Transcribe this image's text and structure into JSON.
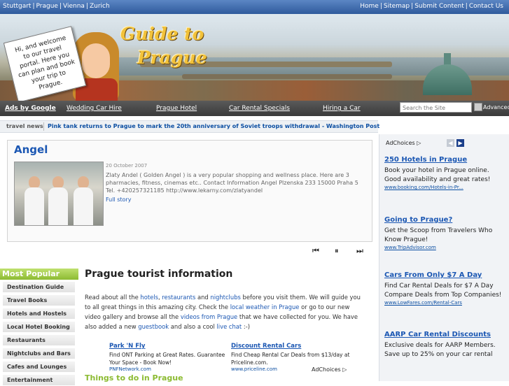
{
  "topbar": {
    "cities": [
      "Stuttgart",
      "Prague",
      "Vienna",
      "Zurich"
    ],
    "links": [
      "Home",
      "Sitemap",
      "Submit Content",
      "Contact Us"
    ]
  },
  "banner": {
    "title_line1": "Guide to",
    "title_line2": "Prague",
    "sign_text": "Hi, and welcome to our travel portal. Here you can plan and book your trip to Prague."
  },
  "nav": {
    "ads_label": "Ads by Google",
    "links": [
      "Wedding Car Hire",
      "Prague Hotel",
      "Car Rental Specials",
      "Hiring a Car"
    ],
    "search_placeholder": "Search the Site",
    "advanced_label": "Advanced"
  },
  "news": {
    "label": "travel news",
    "headline": "Pink tank returns to Prague to mark the 20th anniversary of Soviet troops withdrawal - Washington Post"
  },
  "feature": {
    "title": "Angel",
    "date": "20 October 2007",
    "body": "Zlaty Andel ( Golden Angel ) is a very popular shopping and wellness place. Here are 3 pharmacies, fitness, cinemas etc.. Contact Information Angel Plzenska 233 15000 Praha 5 Tel. +420257321185 http://www.lekarny.com/zlatyandel",
    "more": "Full story",
    "controls": [
      "⏮",
      "⏸",
      "⏭"
    ]
  },
  "sidebar": {
    "heading": "Most Popular",
    "items": [
      "Destination Guide",
      "Travel Books",
      "Hotels and Hostels",
      "Local Hotel Booking",
      "Restaurants",
      "Nightclubs and Bars",
      "Cafes and Lounges",
      "Entertainment"
    ]
  },
  "main": {
    "heading": "Prague tourist information",
    "p1_a": "Read about all the ",
    "link_hotels": "hotels",
    "p1_b": ", ",
    "link_restaurants": "restaurants",
    "p1_c": " and ",
    "link_nightclubs": "nightclubs",
    "p1_d": " before you visit them. We will guide you to all great things in this amazing city. Check the ",
    "link_weather": "local weather in Prague",
    "p1_e": " or go to our new video gallery and browse all the ",
    "link_videos": "videos from Prague",
    "p1_f": " that we have collected for you. We have also added a new ",
    "link_guestbook": "guestbook",
    "p1_g": " and also a cool ",
    "link_chat": "live chat",
    "p1_h": " :-)",
    "things_heading": "Things to do in Prague"
  },
  "inline_ads": [
    {
      "title": "Park 'N Fly",
      "desc": "Find ONT Parking at Great Rates. Guarantee Your Space - Book Now!",
      "url": "PNFNetwork.com"
    },
    {
      "title": "Discount Rental Cars",
      "desc": "Find Cheap Rental Car Deals from $13/day at Priceline.com.",
      "url": "www.priceline.com"
    }
  ],
  "inline_adchoices": "AdChoices ▷",
  "right_ads": {
    "adchoices": "AdChoices ▷",
    "ads": [
      {
        "title": "250 Hotels in Prague",
        "desc": "Book your hotel in Prague online. Good availability and great rates!",
        "url": "www.booking.com/Hotels-in-Pr..."
      },
      {
        "title": "Going to Prague?",
        "desc": "Get the Scoop from Travelers Who Know Prague!",
        "url": "www.TripAdvisor.com"
      },
      {
        "title": "Cars From Only $7 A Day",
        "desc": "Find Car Rental Deals for $7 A Day Compare Deals from Top Companies!",
        "url": "www.LowFares.com/Rental-Cars"
      },
      {
        "title": "AARP Car Rental Discounts",
        "desc": "Exclusive deals for AARP Members. Save up to 25% on your car rental",
        "url": ""
      }
    ]
  }
}
